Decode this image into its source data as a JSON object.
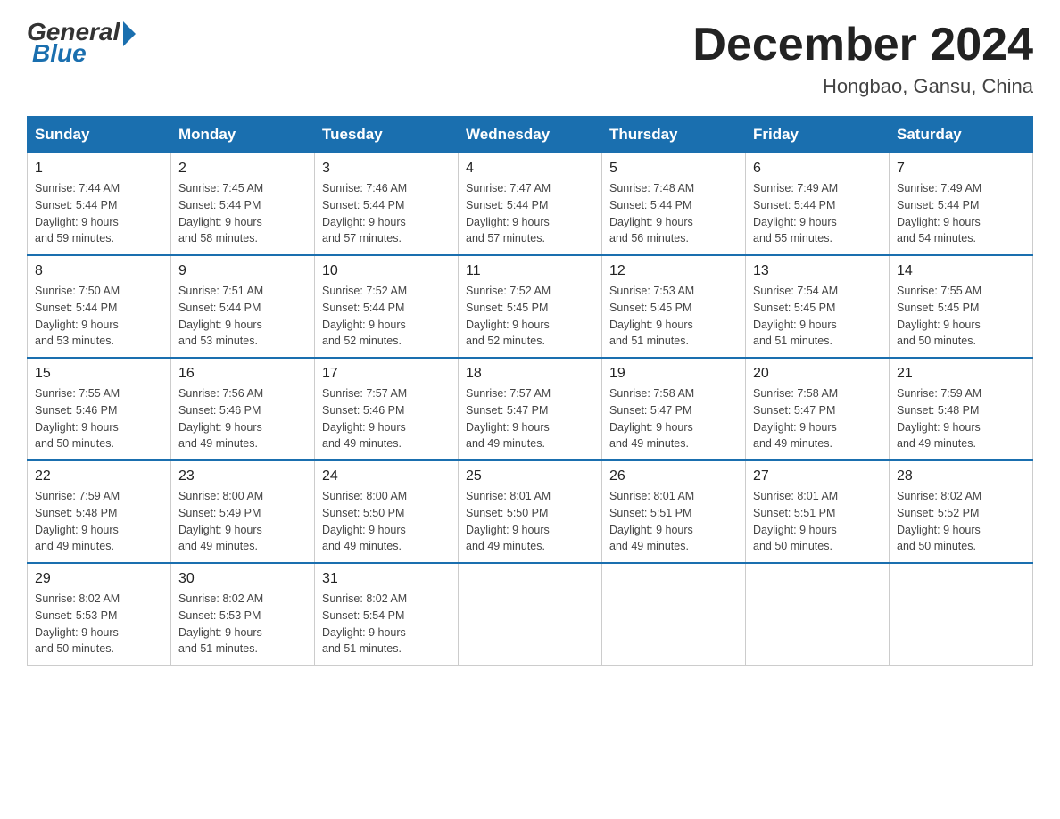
{
  "logo": {
    "general": "General",
    "blue": "Blue"
  },
  "header": {
    "title": "December 2024",
    "subtitle": "Hongbao, Gansu, China"
  },
  "days": [
    "Sunday",
    "Monday",
    "Tuesday",
    "Wednesday",
    "Thursday",
    "Friday",
    "Saturday"
  ],
  "weeks": [
    [
      {
        "day": "1",
        "sunrise": "7:44 AM",
        "sunset": "5:44 PM",
        "daylight": "9 hours and 59 minutes."
      },
      {
        "day": "2",
        "sunrise": "7:45 AM",
        "sunset": "5:44 PM",
        "daylight": "9 hours and 58 minutes."
      },
      {
        "day": "3",
        "sunrise": "7:46 AM",
        "sunset": "5:44 PM",
        "daylight": "9 hours and 57 minutes."
      },
      {
        "day": "4",
        "sunrise": "7:47 AM",
        "sunset": "5:44 PM",
        "daylight": "9 hours and 57 minutes."
      },
      {
        "day": "5",
        "sunrise": "7:48 AM",
        "sunset": "5:44 PM",
        "daylight": "9 hours and 56 minutes."
      },
      {
        "day": "6",
        "sunrise": "7:49 AM",
        "sunset": "5:44 PM",
        "daylight": "9 hours and 55 minutes."
      },
      {
        "day": "7",
        "sunrise": "7:49 AM",
        "sunset": "5:44 PM",
        "daylight": "9 hours and 54 minutes."
      }
    ],
    [
      {
        "day": "8",
        "sunrise": "7:50 AM",
        "sunset": "5:44 PM",
        "daylight": "9 hours and 53 minutes."
      },
      {
        "day": "9",
        "sunrise": "7:51 AM",
        "sunset": "5:44 PM",
        "daylight": "9 hours and 53 minutes."
      },
      {
        "day": "10",
        "sunrise": "7:52 AM",
        "sunset": "5:44 PM",
        "daylight": "9 hours and 52 minutes."
      },
      {
        "day": "11",
        "sunrise": "7:52 AM",
        "sunset": "5:45 PM",
        "daylight": "9 hours and 52 minutes."
      },
      {
        "day": "12",
        "sunrise": "7:53 AM",
        "sunset": "5:45 PM",
        "daylight": "9 hours and 51 minutes."
      },
      {
        "day": "13",
        "sunrise": "7:54 AM",
        "sunset": "5:45 PM",
        "daylight": "9 hours and 51 minutes."
      },
      {
        "day": "14",
        "sunrise": "7:55 AM",
        "sunset": "5:45 PM",
        "daylight": "9 hours and 50 minutes."
      }
    ],
    [
      {
        "day": "15",
        "sunrise": "7:55 AM",
        "sunset": "5:46 PM",
        "daylight": "9 hours and 50 minutes."
      },
      {
        "day": "16",
        "sunrise": "7:56 AM",
        "sunset": "5:46 PM",
        "daylight": "9 hours and 49 minutes."
      },
      {
        "day": "17",
        "sunrise": "7:57 AM",
        "sunset": "5:46 PM",
        "daylight": "9 hours and 49 minutes."
      },
      {
        "day": "18",
        "sunrise": "7:57 AM",
        "sunset": "5:47 PM",
        "daylight": "9 hours and 49 minutes."
      },
      {
        "day": "19",
        "sunrise": "7:58 AM",
        "sunset": "5:47 PM",
        "daylight": "9 hours and 49 minutes."
      },
      {
        "day": "20",
        "sunrise": "7:58 AM",
        "sunset": "5:47 PM",
        "daylight": "9 hours and 49 minutes."
      },
      {
        "day": "21",
        "sunrise": "7:59 AM",
        "sunset": "5:48 PM",
        "daylight": "9 hours and 49 minutes."
      }
    ],
    [
      {
        "day": "22",
        "sunrise": "7:59 AM",
        "sunset": "5:48 PM",
        "daylight": "9 hours and 49 minutes."
      },
      {
        "day": "23",
        "sunrise": "8:00 AM",
        "sunset": "5:49 PM",
        "daylight": "9 hours and 49 minutes."
      },
      {
        "day": "24",
        "sunrise": "8:00 AM",
        "sunset": "5:50 PM",
        "daylight": "9 hours and 49 minutes."
      },
      {
        "day": "25",
        "sunrise": "8:01 AM",
        "sunset": "5:50 PM",
        "daylight": "9 hours and 49 minutes."
      },
      {
        "day": "26",
        "sunrise": "8:01 AM",
        "sunset": "5:51 PM",
        "daylight": "9 hours and 49 minutes."
      },
      {
        "day": "27",
        "sunrise": "8:01 AM",
        "sunset": "5:51 PM",
        "daylight": "9 hours and 50 minutes."
      },
      {
        "day": "28",
        "sunrise": "8:02 AM",
        "sunset": "5:52 PM",
        "daylight": "9 hours and 50 minutes."
      }
    ],
    [
      {
        "day": "29",
        "sunrise": "8:02 AM",
        "sunset": "5:53 PM",
        "daylight": "9 hours and 50 minutes."
      },
      {
        "day": "30",
        "sunrise": "8:02 AM",
        "sunset": "5:53 PM",
        "daylight": "9 hours and 51 minutes."
      },
      {
        "day": "31",
        "sunrise": "8:02 AM",
        "sunset": "5:54 PM",
        "daylight": "9 hours and 51 minutes."
      },
      null,
      null,
      null,
      null
    ]
  ]
}
